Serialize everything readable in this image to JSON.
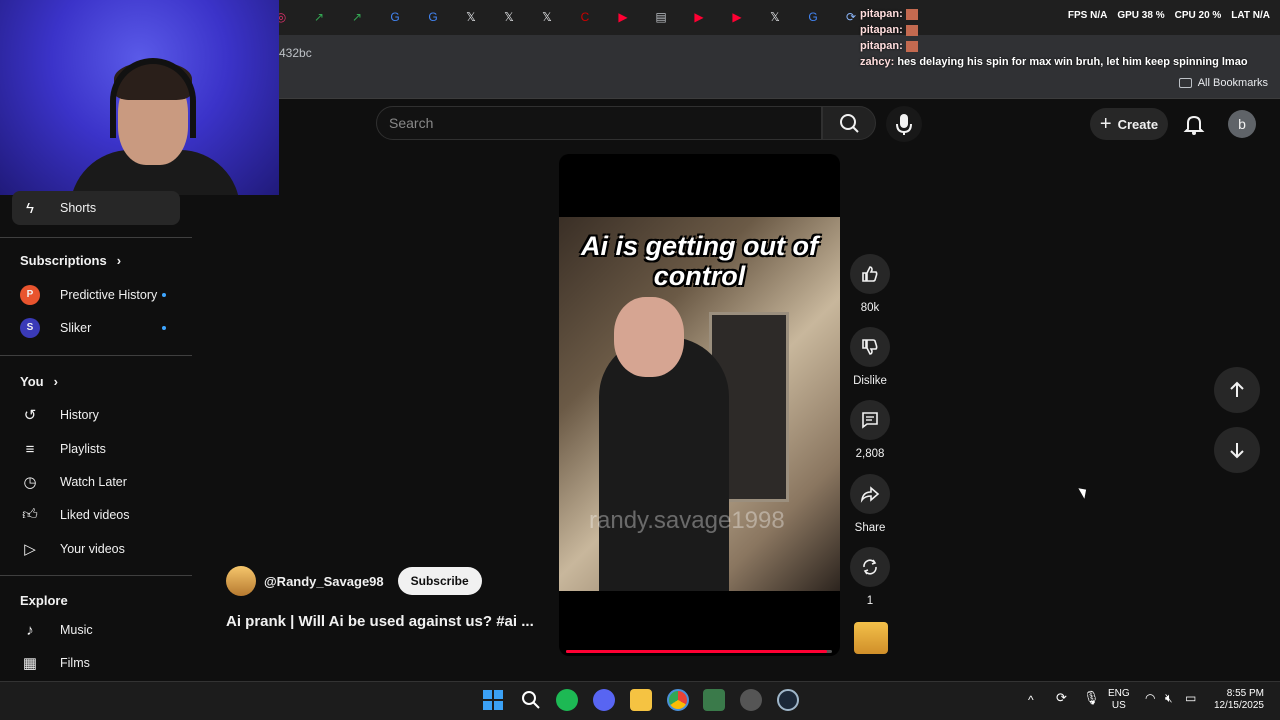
{
  "browser": {
    "url_fragment": "432bc",
    "all_bookmarks": "All Bookmarks",
    "tabs": [
      "instagram-icon",
      "trend-icon",
      "trend-icon",
      "google-icon",
      "google-icon",
      "x-icon",
      "x-icon",
      "x-icon",
      "cnn-icon",
      "youtube-icon",
      "shop-icon",
      "youtube-icon",
      "youtube-icon",
      "x-icon",
      "google-icon",
      "sync-icon"
    ]
  },
  "hud": {
    "fps": "FPS N/A",
    "gpu": "GPU 38 %",
    "cpu": "CPU 20 %",
    "lat": "LAT N/A"
  },
  "chat": [
    {
      "name": "pitapan:",
      "text": ""
    },
    {
      "name": "pitapan:",
      "text": ""
    },
    {
      "name": "pitapan:",
      "text": ""
    },
    {
      "name": "zahcy:",
      "text": "hes delaying his spin for max win bruh, let him keep spinning lmao"
    }
  ],
  "masthead": {
    "search_placeholder": "Search",
    "create_label": "Create",
    "avatar_letter": "b"
  },
  "sidebar": {
    "shorts": "Shorts",
    "subscriptions_heading": "Subscriptions",
    "subscriptions": [
      {
        "name": "Predictive History",
        "initial": "P",
        "color": "#e8542e"
      },
      {
        "name": "Sliker",
        "initial": "S",
        "color": "#3a3ab8"
      }
    ],
    "you_heading": "You",
    "you_items": [
      {
        "label": "History",
        "icon": "history-icon"
      },
      {
        "label": "Playlists",
        "icon": "playlists-icon"
      },
      {
        "label": "Watch Later",
        "icon": "clock-icon"
      },
      {
        "label": "Liked videos",
        "icon": "thumbs-up-icon"
      },
      {
        "label": "Your videos",
        "icon": "play-box-icon"
      }
    ],
    "explore_heading": "Explore",
    "explore_items": [
      {
        "label": "Music",
        "icon": "music-icon"
      },
      {
        "label": "Films",
        "icon": "film-icon"
      }
    ]
  },
  "video": {
    "caption": "Ai is getting out of control",
    "watermark": "randy.savage1998",
    "progress": 0.98,
    "channel": "@Randy_Savage98",
    "subscribe_label": "Subscribe",
    "title": "Ai prank | Will Ai be used against us? #ai ..."
  },
  "actions": {
    "likes": "80k",
    "dislike": "Dislike",
    "comments": "2,808",
    "share": "Share",
    "remix": "1"
  },
  "taskbar": {
    "lang_top": "ENG",
    "lang_bottom": "US",
    "time": "8:55 PM",
    "date": "12/15/2025"
  },
  "colors": {
    "youtube_red": "#ff0033",
    "accent_blue": "#3ea6ff"
  }
}
